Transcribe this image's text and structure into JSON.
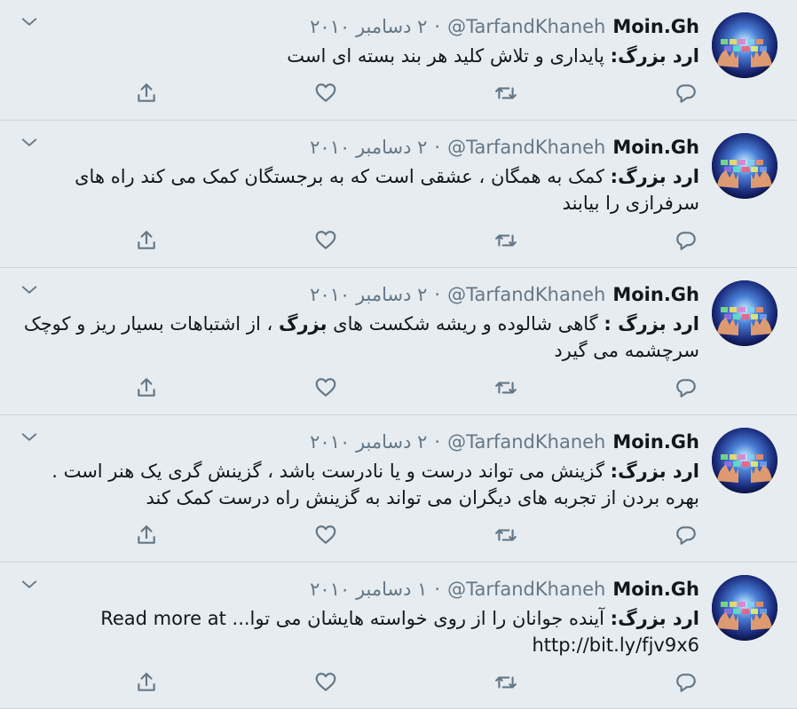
{
  "colors": {
    "background": "#e6ecf0",
    "icon": "#657786",
    "text": "#14171a",
    "meta": "#657786"
  },
  "tweets": [
    {
      "name": "Moin.Gh",
      "handle": "@TarfandKhaneh",
      "separator": "·",
      "date": "۲ دسامبر ۲۰۱۰",
      "prefix": "ارد بزرگ",
      "colon": ":",
      "body": " پایداری و تلاش کلید هر بند بسته ای است",
      "link": ""
    },
    {
      "name": "Moin.Gh",
      "handle": "@TarfandKhaneh",
      "separator": "·",
      "date": "۲ دسامبر ۲۰۱۰",
      "prefix": "ارد بزرگ",
      "colon": ":",
      "body": " کمک به همگان ، عشقی است که به برجستگان کمک می کند راه های سرفرازی را بیابند",
      "link": ""
    },
    {
      "name": "Moin.Gh",
      "handle": "@TarfandKhaneh",
      "separator": "·",
      "date": "۲ دسامبر ۲۰۱۰",
      "prefix": "ارد بزرگ",
      "colon": " :",
      "body_before": " گاهی شالوده و ریشه شکست های ",
      "body_bold": "بزرگ",
      "body_after": " ، از اشتباهات بسیار ریز و کوچک سرچشمه می گیرد",
      "link": ""
    },
    {
      "name": "Moin.Gh",
      "handle": "@TarfandKhaneh",
      "separator": "·",
      "date": "۲ دسامبر ۲۰۱۰",
      "prefix": "ارد بزرگ",
      "colon": ":",
      "body": " گزینش می تواند درست و یا نادرست باشد ، گزینش گری یک هنر است . بهره بردن از تجربه های دیگران می تواند به گزینش راه درست کمک کند",
      "link": ""
    },
    {
      "name": "Moin.Gh",
      "handle": "@TarfandKhaneh",
      "separator": "·",
      "date": "۱ دسامبر ۲۰۱۰",
      "prefix": "ارد بزرگ",
      "colon": ":",
      "body": " آینده جوانان را از روی خواسته هایشان می توا... Read more at",
      "link": "http://bit.ly/fjv9x6"
    }
  ],
  "icons": {
    "reply": "reply-icon",
    "retweet": "retweet-icon",
    "like": "heart-icon",
    "share": "share-icon",
    "caret": "chevron-down-icon",
    "avatar": "avatar"
  }
}
